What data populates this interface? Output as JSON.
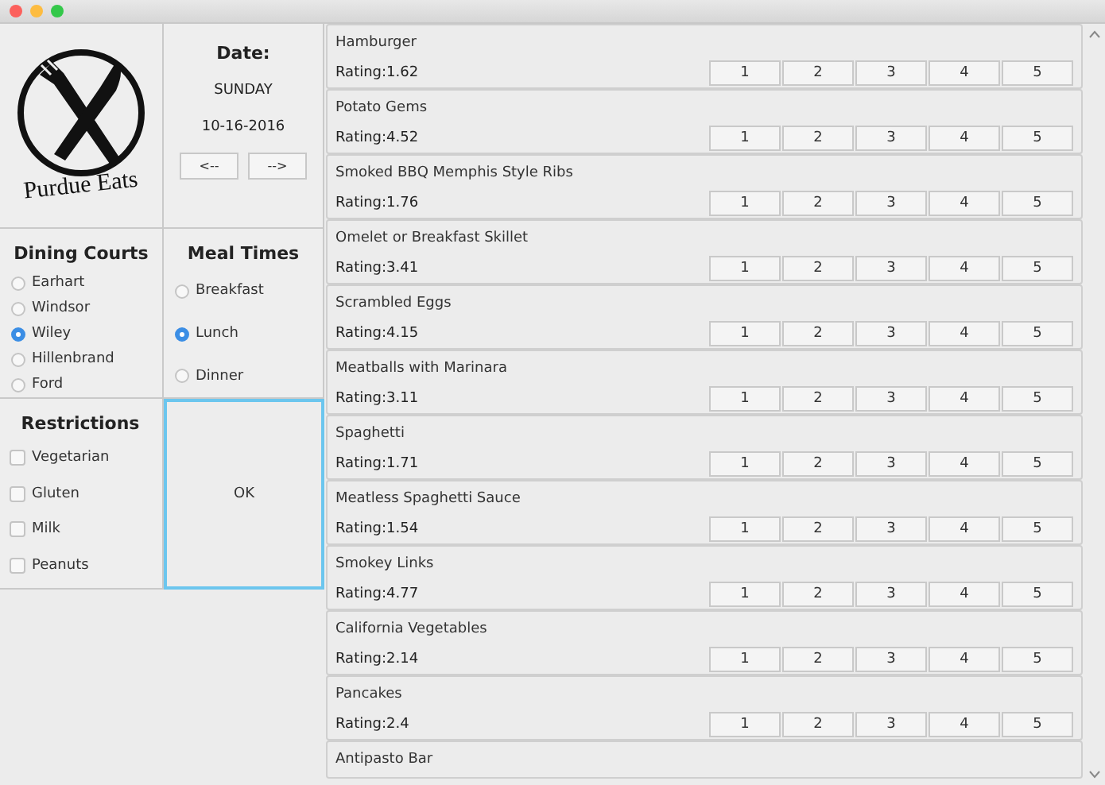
{
  "logo": {
    "text": "Purdue Eats"
  },
  "date": {
    "title": "Date:",
    "weekday": "SUNDAY",
    "value": "10-16-2016",
    "prev": "<--",
    "next": "-->"
  },
  "dining_courts": {
    "title": "Dining Courts",
    "options": [
      {
        "label": "Earhart",
        "selected": false
      },
      {
        "label": "Windsor",
        "selected": false
      },
      {
        "label": "Wiley",
        "selected": true
      },
      {
        "label": "Hillenbrand",
        "selected": false
      },
      {
        "label": "Ford",
        "selected": false
      }
    ]
  },
  "meal_times": {
    "title": "Meal Times",
    "options": [
      {
        "label": "Breakfast",
        "selected": false
      },
      {
        "label": "Lunch",
        "selected": true
      },
      {
        "label": "Dinner",
        "selected": false
      }
    ]
  },
  "restrictions": {
    "title": "Restrictions",
    "options": [
      {
        "label": "Vegetarian",
        "checked": false
      },
      {
        "label": "Gluten",
        "checked": false
      },
      {
        "label": "Milk",
        "checked": false
      },
      {
        "label": "Peanuts",
        "checked": false
      }
    ]
  },
  "ok_button": "OK",
  "menu_items": [
    {
      "name": "Hamburger",
      "rating": "Rating:1.62",
      "buttons": [
        "1",
        "2",
        "3",
        "4",
        "5"
      ]
    },
    {
      "name": "Potato Gems",
      "rating": "Rating:4.52",
      "buttons": [
        "1",
        "2",
        "3",
        "4",
        "5"
      ]
    },
    {
      "name": "Smoked BBQ Memphis Style Ribs",
      "rating": "Rating:1.76",
      "buttons": [
        "1",
        "2",
        "3",
        "4",
        "5"
      ]
    },
    {
      "name": "Omelet or Breakfast Skillet",
      "rating": "Rating:3.41",
      "buttons": [
        "1",
        "2",
        "3",
        "4",
        "5"
      ]
    },
    {
      "name": "Scrambled Eggs",
      "rating": "Rating:4.15",
      "buttons": [
        "1",
        "2",
        "3",
        "4",
        "5"
      ]
    },
    {
      "name": "Meatballs with Marinara",
      "rating": "Rating:3.11",
      "buttons": [
        "1",
        "2",
        "3",
        "4",
        "5"
      ]
    },
    {
      "name": "Spaghetti",
      "rating": "Rating:1.71",
      "buttons": [
        "1",
        "2",
        "3",
        "4",
        "5"
      ]
    },
    {
      "name": "Meatless Spaghetti Sauce",
      "rating": "Rating:1.54",
      "buttons": [
        "1",
        "2",
        "3",
        "4",
        "5"
      ]
    },
    {
      "name": "Smokey Links",
      "rating": "Rating:4.77",
      "buttons": [
        "1",
        "2",
        "3",
        "4",
        "5"
      ]
    },
    {
      "name": "California Vegetables",
      "rating": "Rating:2.14",
      "buttons": [
        "1",
        "2",
        "3",
        "4",
        "5"
      ]
    },
    {
      "name": "Pancakes",
      "rating": "Rating:2.4",
      "buttons": [
        "1",
        "2",
        "3",
        "4",
        "5"
      ]
    },
    {
      "name": "Antipasto Bar"
    }
  ]
}
